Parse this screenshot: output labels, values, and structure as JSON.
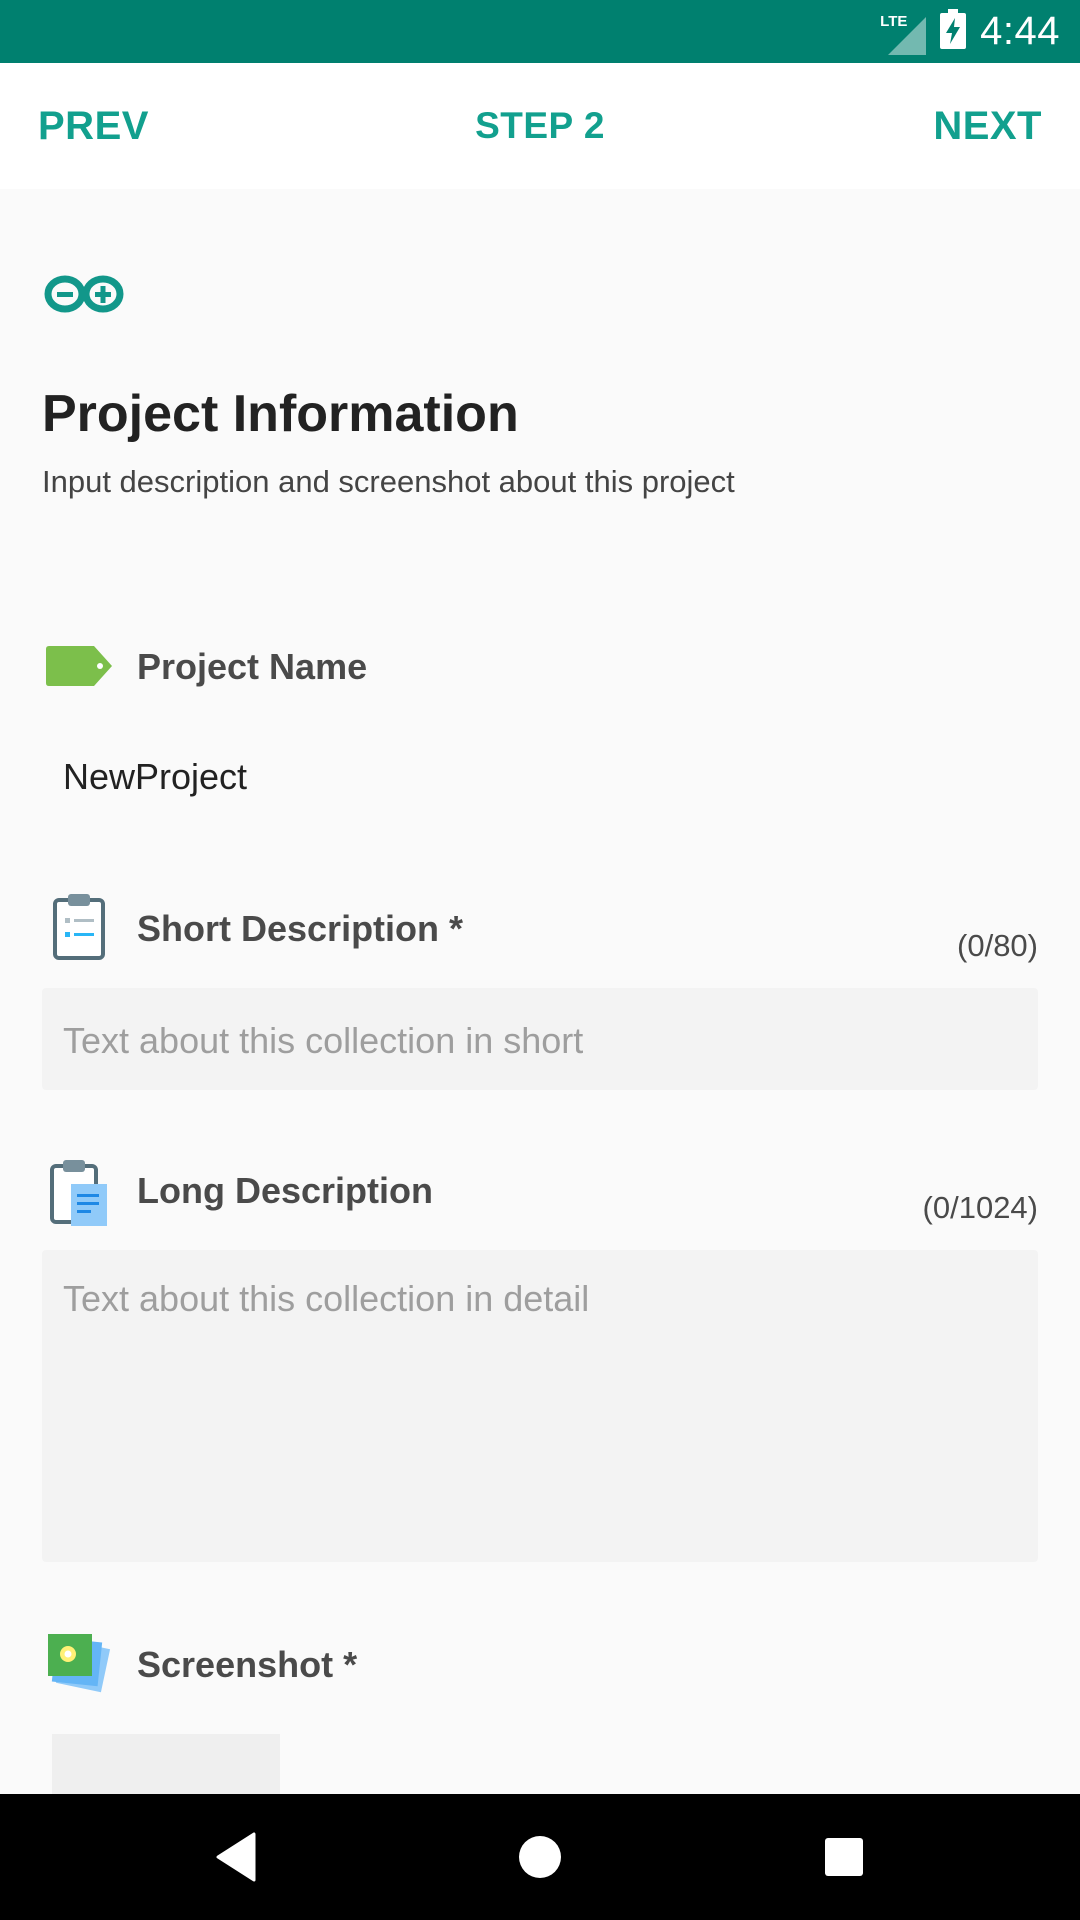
{
  "status_bar": {
    "network": "LTE",
    "time": "4:44",
    "icons": [
      "lte-signal-icon",
      "battery-charging-icon"
    ],
    "color": "#00806f"
  },
  "top_nav": {
    "prev_label": "PREV",
    "step_label": "STEP 2",
    "next_label": "NEXT",
    "accent_color": "#12a08e"
  },
  "header": {
    "logo_icon": "arduino-logo-icon",
    "title": "Project Information",
    "subtitle": "Input description and screenshot about this project"
  },
  "fields": {
    "project_name": {
      "icon": "tag-icon",
      "label": "Project Name",
      "value": "NewProject"
    },
    "short_description": {
      "icon": "clipboard-list-icon",
      "label": "Short Description *",
      "counter": "(0/80)",
      "placeholder": "Text about this collection in short"
    },
    "long_description": {
      "icon": "clipboard-document-icon",
      "label": "Long Description",
      "counter": "(0/1024)",
      "placeholder": "Text about this collection in detail"
    },
    "screenshot": {
      "icon": "photos-icon",
      "label": "Screenshot *"
    }
  },
  "nav_bar": {
    "buttons": [
      "back-icon",
      "home-icon",
      "recents-icon"
    ]
  }
}
